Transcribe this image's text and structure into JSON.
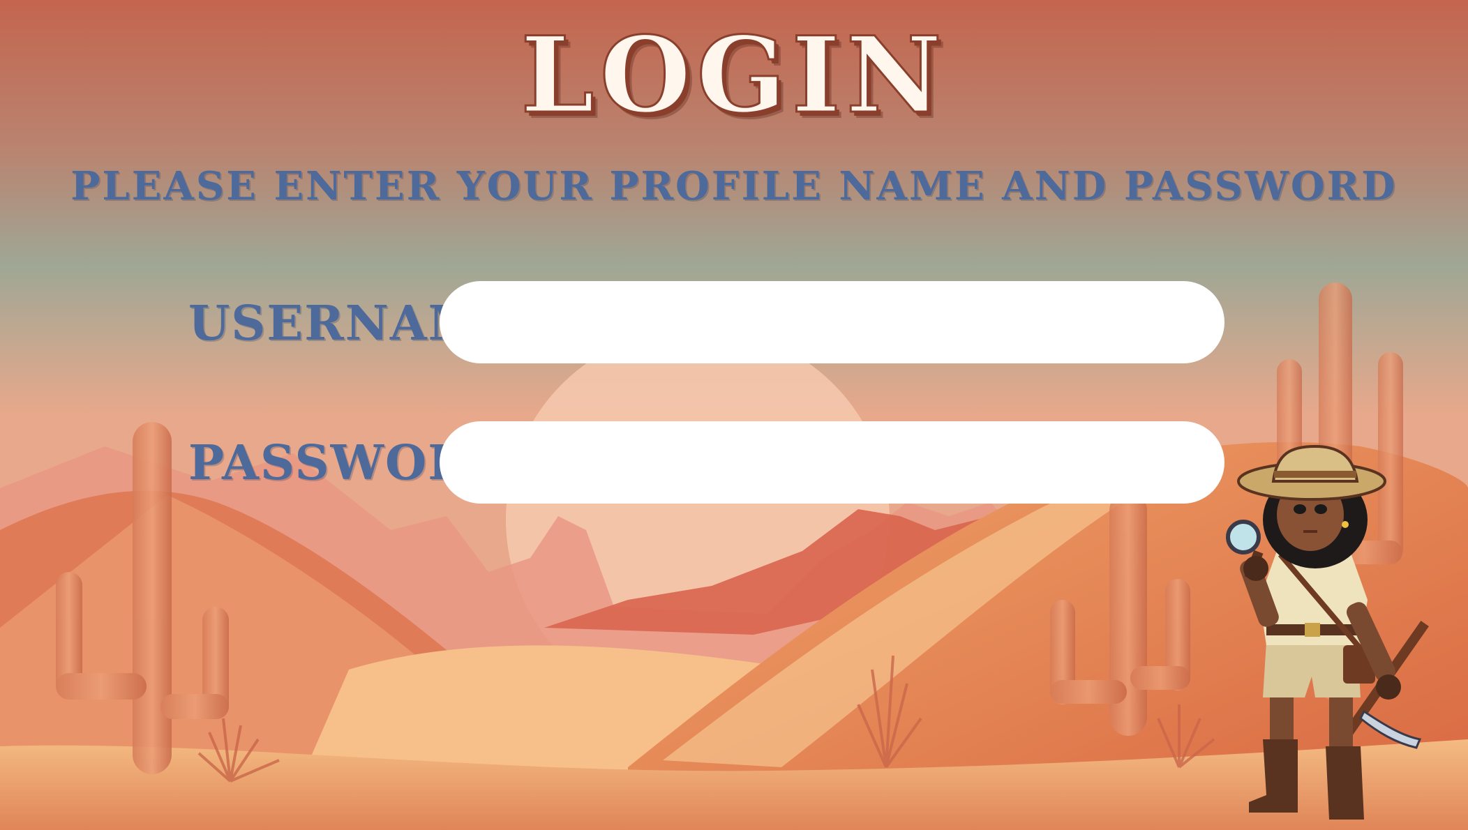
{
  "screen": {
    "title": "LOGIN",
    "subtitle": "PLEASE ENTER YOUR PROFILE NAME AND PASSWORD"
  },
  "form": {
    "username_label": "USERNAME",
    "username_value": "",
    "username_placeholder": "",
    "password_label": "PASSWORD",
    "password_value": "",
    "password_placeholder": ""
  },
  "colors": {
    "sky_top": "#c4654e",
    "sky_mid": "#9fa795",
    "sand": "#f2a86a",
    "label_blue": "#4d6a9b",
    "input_bg": "#ffffff"
  },
  "icons": [
    "cactus-icon",
    "desert-sun",
    "explorer-character",
    "pickaxe-icon",
    "magnifier-icon"
  ]
}
